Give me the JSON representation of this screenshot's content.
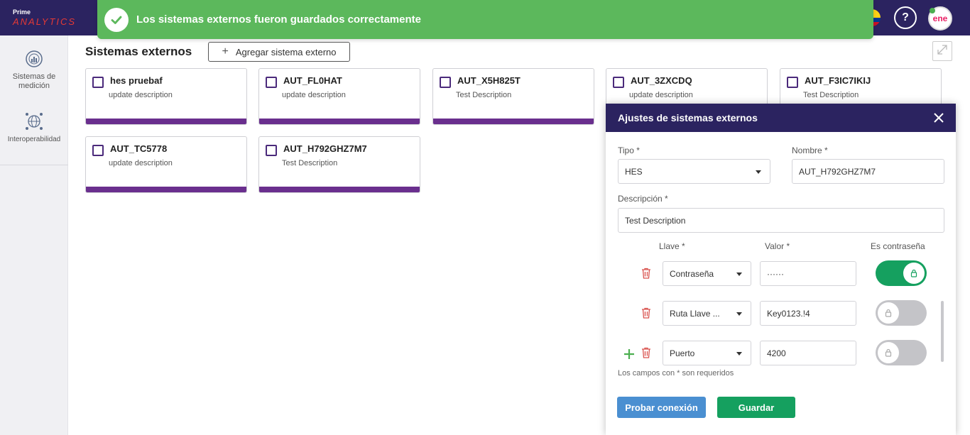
{
  "app": {
    "logo_line1": "Prime",
    "logo_line2": "ANALYTICS",
    "help_label": "?",
    "avatar_text": "ene",
    "flag_colors": [
      "#fcd116",
      "#003893",
      "#ce1126"
    ]
  },
  "toast": {
    "message": "Los sistemas externos fueron guardados correctamente",
    "color": "#5cb85c"
  },
  "sidebar": {
    "items": [
      {
        "label": "Sistemas de medición",
        "icon": "chart-meter-icon"
      },
      {
        "label": "Interoperabilidad",
        "icon": "network-globe-icon"
      }
    ]
  },
  "main": {
    "title": "Sistemas externos",
    "add_button": "Agregar sistema externo",
    "cards": [
      {
        "name": "hes pruebaf",
        "description": "update description"
      },
      {
        "name": "AUT_FL0HAT",
        "description": "update description"
      },
      {
        "name": "AUT_X5H825T",
        "description": "Test Description"
      },
      {
        "name": "AUT_3ZXCDQ",
        "description": "update description"
      },
      {
        "name": "AUT_F3IC7IKIJ",
        "description": "Test Description"
      },
      {
        "name": "AUT_TC5778",
        "description": "update description"
      },
      {
        "name": "AUT_H792GHZ7M7",
        "description": "Test Description"
      }
    ]
  },
  "panel": {
    "title": "Ajustes de sistemas externos",
    "tipo_label": "Tipo *",
    "tipo_value": "HES",
    "nombre_label": "Nombre *",
    "nombre_value": "AUT_H792GHZ7M7",
    "descripcion_label": "Descripción *",
    "descripcion_value": "Test Description",
    "col_llave": "Llave *",
    "col_valor": "Valor *",
    "col_password": "Es contraseña",
    "rows": [
      {
        "key": "Contraseña",
        "value": "······",
        "is_password": true
      },
      {
        "key": "Ruta Llave ...",
        "value": "Key0123.!4",
        "is_password": false
      },
      {
        "key": "Puerto",
        "value": "4200",
        "is_password": false
      }
    ],
    "required_note": "Los campos con * son requeridos",
    "test_button": "Probar conexión",
    "save_button": "Guardar"
  }
}
